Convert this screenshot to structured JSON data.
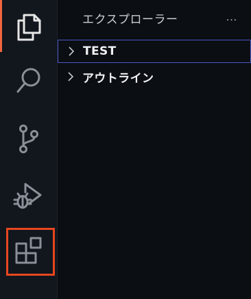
{
  "activity_bar": {
    "items": [
      {
        "name": "explorer",
        "icon": "files-icon",
        "active": true
      },
      {
        "name": "search",
        "icon": "search-icon",
        "active": false
      },
      {
        "name": "source-control",
        "icon": "source-control-icon",
        "active": false
      },
      {
        "name": "run-and-debug",
        "icon": "run-debug-icon",
        "active": false
      },
      {
        "name": "extensions",
        "icon": "extensions-icon",
        "active": false,
        "highlighted": true
      }
    ],
    "accent_color": "#f0663f",
    "highlight_color": "#e8471f"
  },
  "sidebar": {
    "title": "エクスプローラー",
    "more_icon": "…",
    "sections": [
      {
        "label": "TEST",
        "expanded": false,
        "focused": true
      },
      {
        "label": "アウトライン",
        "expanded": false,
        "focused": false
      }
    ]
  },
  "colors": {
    "background": "#0b0e13",
    "activity_bar_bg": "#12161d",
    "focus_border": "#4c5ac7"
  }
}
